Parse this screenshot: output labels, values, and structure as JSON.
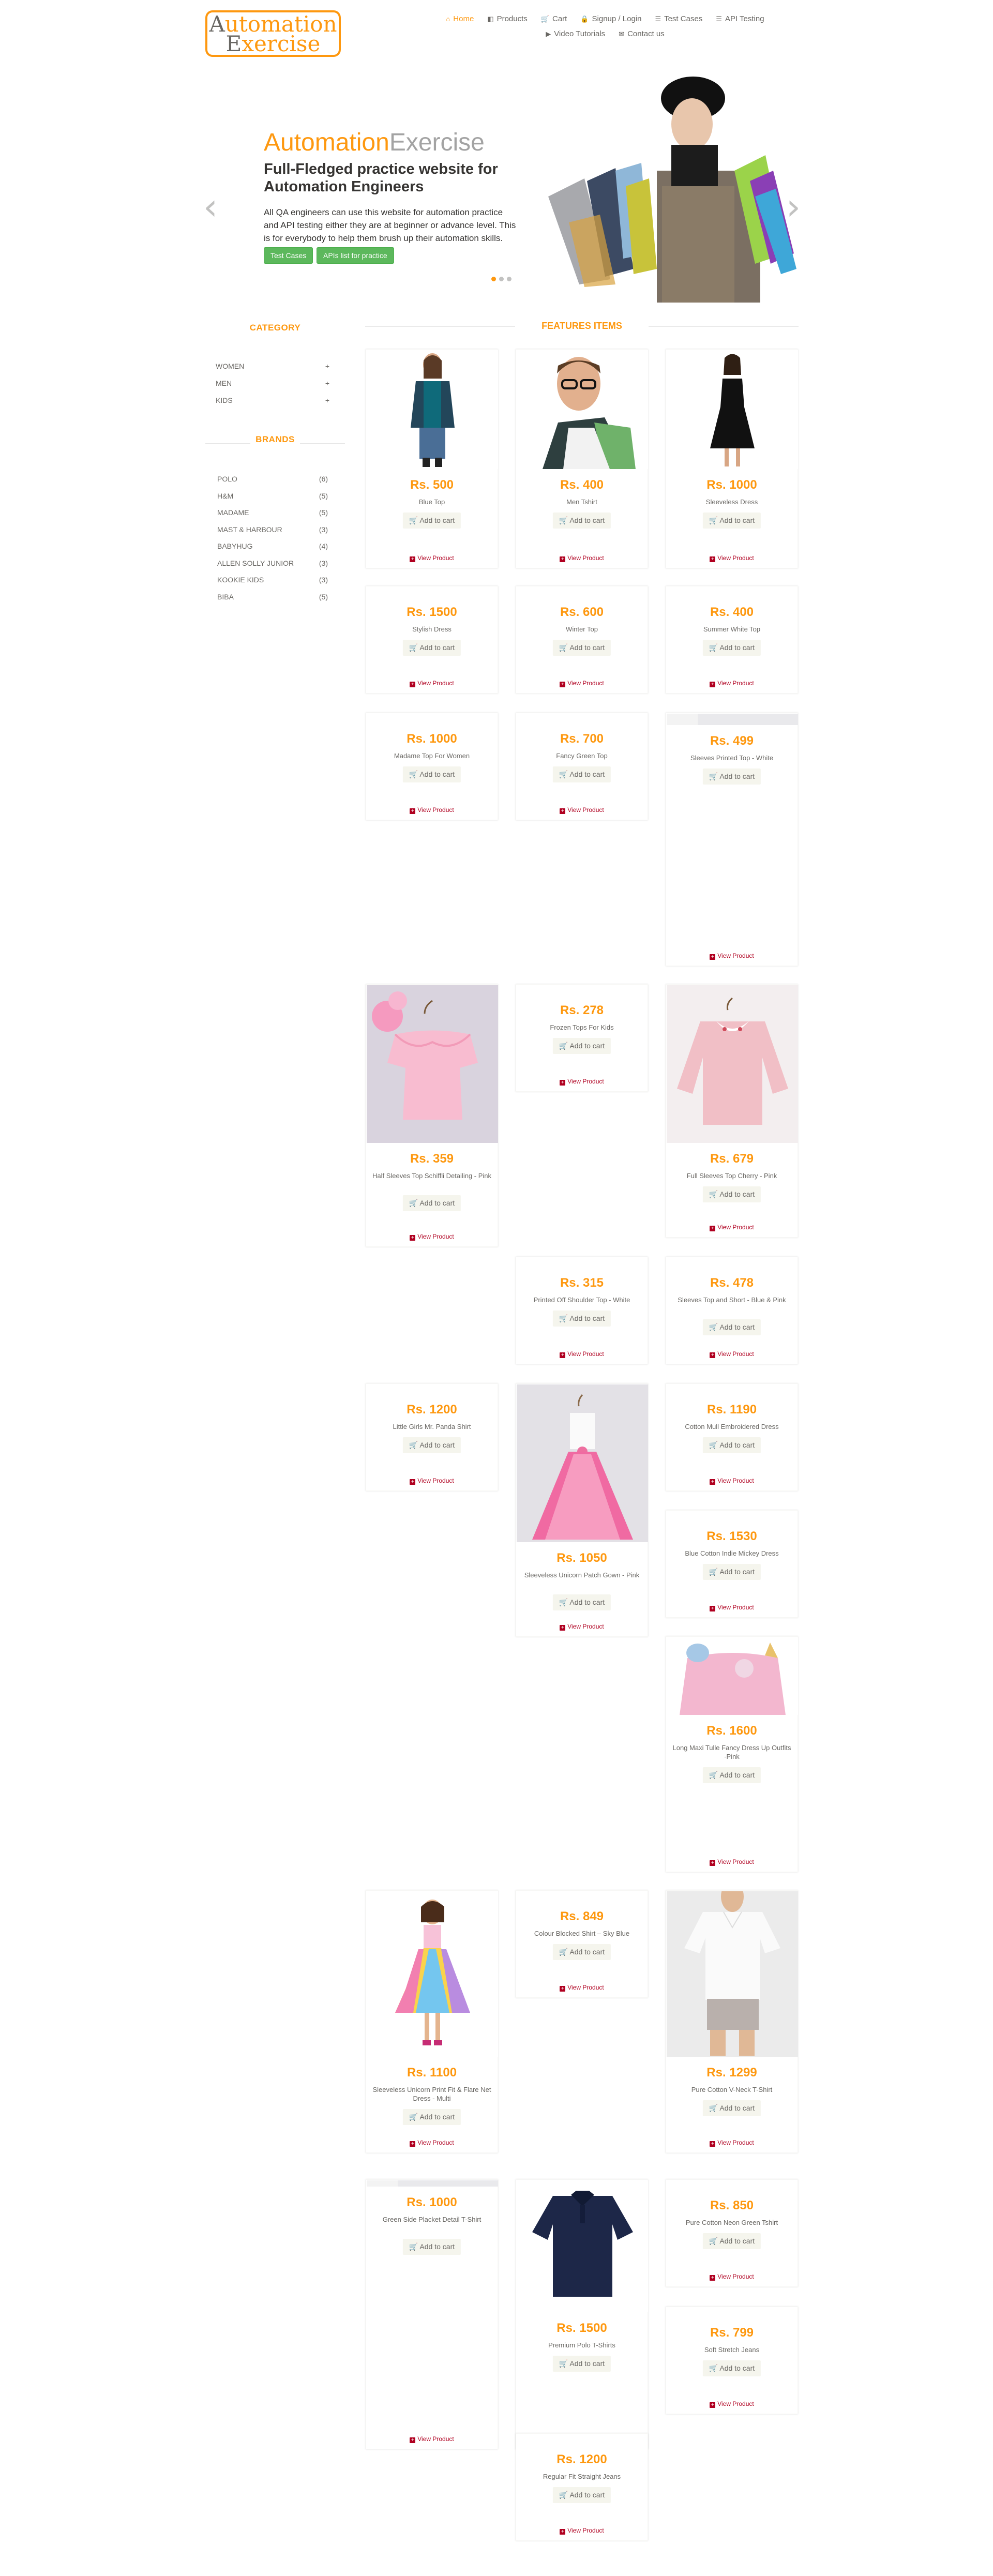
{
  "logo": {
    "line1_cap": "A",
    "line1_rest": "utomation",
    "line2_cap": "E",
    "line2_rest": "xercise"
  },
  "nav": {
    "row1": [
      {
        "label": "Home",
        "icon": "home-icon",
        "active": true
      },
      {
        "label": "Products",
        "icon": "products-icon"
      },
      {
        "label": "Cart",
        "icon": "cart-icon"
      },
      {
        "label": "Signup / Login",
        "icon": "lock-icon"
      },
      {
        "label": "Test Cases",
        "icon": "list-icon"
      },
      {
        "label": "API Testing",
        "icon": "list-icon"
      }
    ],
    "row2": [
      {
        "label": "Video Tutorials",
        "icon": "youtube-icon"
      },
      {
        "label": "Contact us",
        "icon": "envelope-icon"
      }
    ]
  },
  "slider": {
    "title_a": "Automation",
    "title_b": "Exercise",
    "heading": "Full-Fledged practice website for Automation Engineers",
    "text": "All QA engineers can use this website for automation practice and API testing either they are at beginner or advance level. This is for everybody to help them brush up their automation skills.",
    "btn_test_cases": "Test Cases",
    "btn_apis": "APIs list for practice",
    "prev": "‹",
    "next": "›"
  },
  "sidebar": {
    "category_title": "CATEGORY",
    "categories": [
      {
        "label": "WOMEN",
        "toggle": "+"
      },
      {
        "label": "MEN",
        "toggle": "+"
      },
      {
        "label": "KIDS",
        "toggle": "+"
      }
    ],
    "brands_title": "BRANDS",
    "brands": [
      {
        "label": "POLO",
        "count": "(6)"
      },
      {
        "label": "H&M",
        "count": "(5)"
      },
      {
        "label": "MADAME",
        "count": "(5)"
      },
      {
        "label": "MAST & HARBOUR",
        "count": "(3)"
      },
      {
        "label": "BABYHUG",
        "count": "(4)"
      },
      {
        "label": "ALLEN SOLLY JUNIOR",
        "count": "(3)"
      },
      {
        "label": "KOOKIE KIDS",
        "count": "(3)"
      },
      {
        "label": "BIBA",
        "count": "(5)"
      }
    ]
  },
  "features_title": "FEATURES ITEMS",
  "labels": {
    "add_to_cart": "Add to cart",
    "view_product": "View Product"
  },
  "products": [
    {
      "price": "Rs. 500",
      "name": "Blue Top"
    },
    {
      "price": "Rs. 400",
      "name": "Men Tshirt"
    },
    {
      "price": "Rs. 1000",
      "name": "Sleeveless Dress"
    },
    {
      "price": "Rs. 1500",
      "name": "Stylish Dress"
    },
    {
      "price": "Rs. 600",
      "name": "Winter Top"
    },
    {
      "price": "Rs. 400",
      "name": "Summer White Top"
    },
    {
      "price": "Rs. 1000",
      "name": "Madame Top For Women"
    },
    {
      "price": "Rs. 700",
      "name": "Fancy Green Top"
    },
    {
      "price": "Rs. 499",
      "name": "Sleeves Printed Top - White"
    },
    {
      "price": "Rs. 359",
      "name": "Half Sleeves Top Schiffli Detailing - Pink"
    },
    {
      "price": "Rs. 278",
      "name": "Frozen Tops For Kids"
    },
    {
      "price": "Rs. 679",
      "name": "Full Sleeves Top Cherry - Pink"
    },
    {
      "price": "Rs. 315",
      "name": "Printed Off Shoulder Top - White"
    },
    {
      "price": "Rs. 478",
      "name": "Sleeves Top and Short - Blue & Pink"
    },
    {
      "price": "Rs. 1200",
      "name": "Little Girls Mr. Panda Shirt"
    },
    {
      "price": "Rs. 1050",
      "name": "Sleeveless Unicorn Patch Gown - Pink"
    },
    {
      "price": "Rs. 1190",
      "name": "Cotton Mull Embroidered Dress"
    },
    {
      "price": "Rs. 1530",
      "name": "Blue Cotton Indie Mickey Dress"
    },
    {
      "price": "Rs. 1600",
      "name": "Long Maxi Tulle Fancy Dress Up Outfits -Pink"
    },
    {
      "price": "Rs. 1100",
      "name": "Sleeveless Unicorn Print Fit & Flare Net Dress - Multi"
    },
    {
      "price": "Rs. 849",
      "name": "Colour Blocked Shirt – Sky Blue"
    },
    {
      "price": "Rs. 1299",
      "name": "Pure Cotton V-Neck T-Shirt"
    },
    {
      "price": "Rs. 1000",
      "name": "Green Side Placket Detail T-Shirt"
    },
    {
      "price": "Rs. 1500",
      "name": "Premium Polo T-Shirts"
    },
    {
      "price": "Rs. 850",
      "name": "Pure Cotton Neon Green Tshirt"
    },
    {
      "price": "Rs. 799",
      "name": "Soft Stretch Jeans"
    },
    {
      "price": "Rs. 1200",
      "name": "Regular Fit Straight Jeans"
    }
  ]
}
